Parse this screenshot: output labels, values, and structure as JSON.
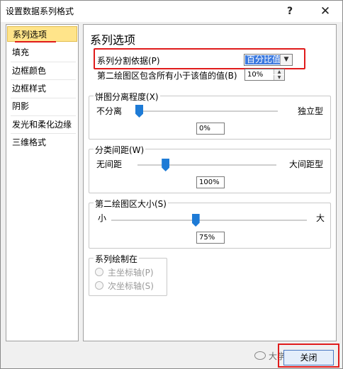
{
  "window": {
    "title": "设置数据系列格式",
    "help": "?",
    "close": "✕"
  },
  "sidebar": {
    "items": [
      "系列选项",
      "填充",
      "边框颜色",
      "边框样式",
      "阴影",
      "发光和柔化边缘",
      "三维格式"
    ]
  },
  "panel": {
    "heading": "系列选项",
    "split_by_label": "系列分割依据(P)",
    "split_by_value": "百分比值",
    "second_plot_label": "第二绘图区包含所有小于该值的值(B)",
    "second_plot_value": "10%",
    "explosion": {
      "legend": "饼图分离程度(X)",
      "min_label": "不分离",
      "max_label": "独立型",
      "value": "0%",
      "fraction": 0.0
    },
    "gap": {
      "legend": "分类间距(W)",
      "min_label": "无间距",
      "max_label": "大间距型",
      "value": "100%",
      "fraction": 0.2
    },
    "second_size": {
      "legend": "第二绘图区大小(S)",
      "min_label": "小",
      "max_label": "大",
      "value": "75%",
      "fraction": 0.43
    },
    "plot_on": {
      "legend": "系列绘制在",
      "primary": "主坐标轴(P)",
      "secondary": "次坐标轴(S)"
    }
  },
  "footer": {
    "close_label": "关闭",
    "watermark": "大学生易孟题"
  }
}
